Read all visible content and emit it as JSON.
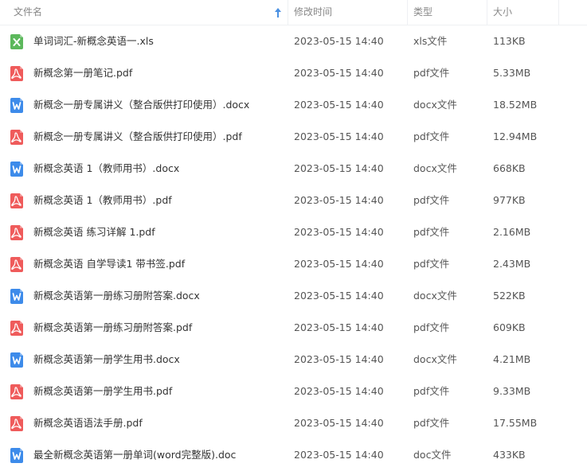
{
  "header": {
    "name_label": "文件名",
    "time_label": "修改时间",
    "type_label": "类型",
    "size_label": "大小",
    "sort_icon": "sort-ascending-arrow-icon"
  },
  "colors": {
    "xls": "#5cb85c",
    "pdf": "#ef5b5b",
    "docx": "#3d8bea",
    "sort_arrow": "#4a90e2"
  },
  "files": [
    {
      "name": "单词词汇-新概念英语一.xls",
      "modified": "2023-05-15 14:40",
      "type": "xls文件",
      "size": "113KB",
      "icon": "xls"
    },
    {
      "name": "新概念第一册笔记.pdf",
      "modified": "2023-05-15 14:40",
      "type": "pdf文件",
      "size": "5.33MB",
      "icon": "pdf"
    },
    {
      "name": "新概念一册专属讲义（整合版供打印使用）.docx",
      "modified": "2023-05-15 14:40",
      "type": "docx文件",
      "size": "18.52MB",
      "icon": "word"
    },
    {
      "name": "新概念一册专属讲义（整合版供打印使用）.pdf",
      "modified": "2023-05-15 14:40",
      "type": "pdf文件",
      "size": "12.94MB",
      "icon": "pdf"
    },
    {
      "name": "新概念英语 1（教师用书）.docx",
      "modified": "2023-05-15 14:40",
      "type": "docx文件",
      "size": "668KB",
      "icon": "word"
    },
    {
      "name": "新概念英语 1（教师用书）.pdf",
      "modified": "2023-05-15 14:40",
      "type": "pdf文件",
      "size": "977KB",
      "icon": "pdf"
    },
    {
      "name": "新概念英语 练习详解 1.pdf",
      "modified": "2023-05-15 14:40",
      "type": "pdf文件",
      "size": "2.16MB",
      "icon": "pdf"
    },
    {
      "name": "新概念英语 自学导读1 带书签.pdf",
      "modified": "2023-05-15 14:40",
      "type": "pdf文件",
      "size": "2.43MB",
      "icon": "pdf"
    },
    {
      "name": "新概念英语第一册练习册附答案.docx",
      "modified": "2023-05-15 14:40",
      "type": "docx文件",
      "size": "522KB",
      "icon": "word"
    },
    {
      "name": "新概念英语第一册练习册附答案.pdf",
      "modified": "2023-05-15 14:40",
      "type": "pdf文件",
      "size": "609KB",
      "icon": "pdf"
    },
    {
      "name": "新概念英语第一册学生用书.docx",
      "modified": "2023-05-15 14:40",
      "type": "docx文件",
      "size": "4.21MB",
      "icon": "word"
    },
    {
      "name": "新概念英语第一册学生用书.pdf",
      "modified": "2023-05-15 14:40",
      "type": "pdf文件",
      "size": "9.33MB",
      "icon": "pdf"
    },
    {
      "name": "新概念英语语法手册.pdf",
      "modified": "2023-05-15 14:40",
      "type": "pdf文件",
      "size": "17.55MB",
      "icon": "pdf"
    },
    {
      "name": "最全新概念英语第一册单词(word完整版).doc",
      "modified": "2023-05-15 14:40",
      "type": "doc文件",
      "size": "433KB",
      "icon": "word"
    }
  ]
}
